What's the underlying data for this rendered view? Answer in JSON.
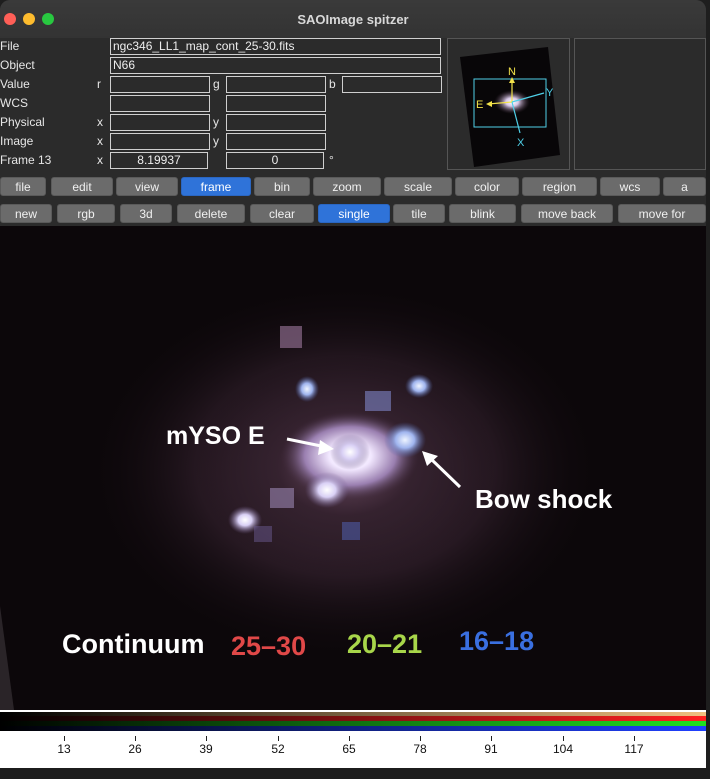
{
  "window": {
    "title": "SAOImage spitzer"
  },
  "info_panel": {
    "rows": [
      {
        "label": "File",
        "value": "ngc346_LL1_map_cont_25-30.fits"
      },
      {
        "label": "Object",
        "value": "N66"
      },
      {
        "label": "Value",
        "sub1": "r",
        "sub2": "g",
        "sub3": "b"
      },
      {
        "label": "WCS"
      },
      {
        "label": "Physical",
        "sub1": "x",
        "sub2": "y"
      },
      {
        "label": "Image",
        "sub1": "x",
        "sub2": "y"
      },
      {
        "label": "Frame 13",
        "sub1": "x",
        "x_value": "8.19937",
        "y_value": "0",
        "unit": "°"
      }
    ]
  },
  "panner": {
    "compass": {
      "north": "N",
      "east": "E",
      "x_axis": "X",
      "y_axis": "Y"
    }
  },
  "main_menu": [
    "file",
    "edit",
    "view",
    "frame",
    "bin",
    "zoom",
    "scale",
    "color",
    "region",
    "wcs",
    "a"
  ],
  "main_menu_active": "frame",
  "frame_menu": [
    "new",
    "rgb",
    "3d",
    "delete",
    "clear",
    "single",
    "tile",
    "blink",
    "move back",
    "move for"
  ],
  "frame_menu_active": "single",
  "image_annotations": {
    "source_label": "mYSO E",
    "shock_label": "Bow shock",
    "legend_prefix": "Continuum",
    "red_band": "25–30",
    "green_band": "20–21",
    "blue_band": "16–18"
  },
  "colors": {
    "red_band": "#e04848",
    "green_band": "#a8d64a",
    "blue_band": "#3a6fe0",
    "active_button": "#2f73d9"
  },
  "colorbar": {
    "ticks": [
      "13",
      "26",
      "39",
      "52",
      "65",
      "78",
      "91",
      "104",
      "117"
    ]
  }
}
